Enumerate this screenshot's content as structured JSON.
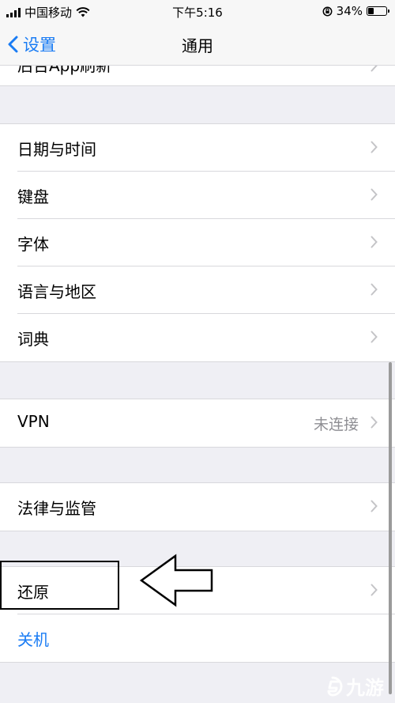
{
  "status_bar": {
    "carrier": "中国移动",
    "time": "下午5:16",
    "battery_percent": "34%",
    "battery_level": 0.34
  },
  "nav": {
    "back_label": "设置",
    "title": "通用"
  },
  "partial_row_label": "后台App刷新",
  "group_locale": [
    {
      "label": "日期与时间"
    },
    {
      "label": "键盘"
    },
    {
      "label": "字体"
    },
    {
      "label": "语言与地区"
    },
    {
      "label": "词典"
    }
  ],
  "vpn": {
    "label": "VPN",
    "value": "未连接"
  },
  "legal": {
    "label": "法律与监管"
  },
  "reset": {
    "label": "还原"
  },
  "shutdown": {
    "label": "关机"
  },
  "watermark": "九游",
  "colors": {
    "accent": "#1a7cf4",
    "background": "#efeff4",
    "secondary_text": "#8e8e93"
  }
}
